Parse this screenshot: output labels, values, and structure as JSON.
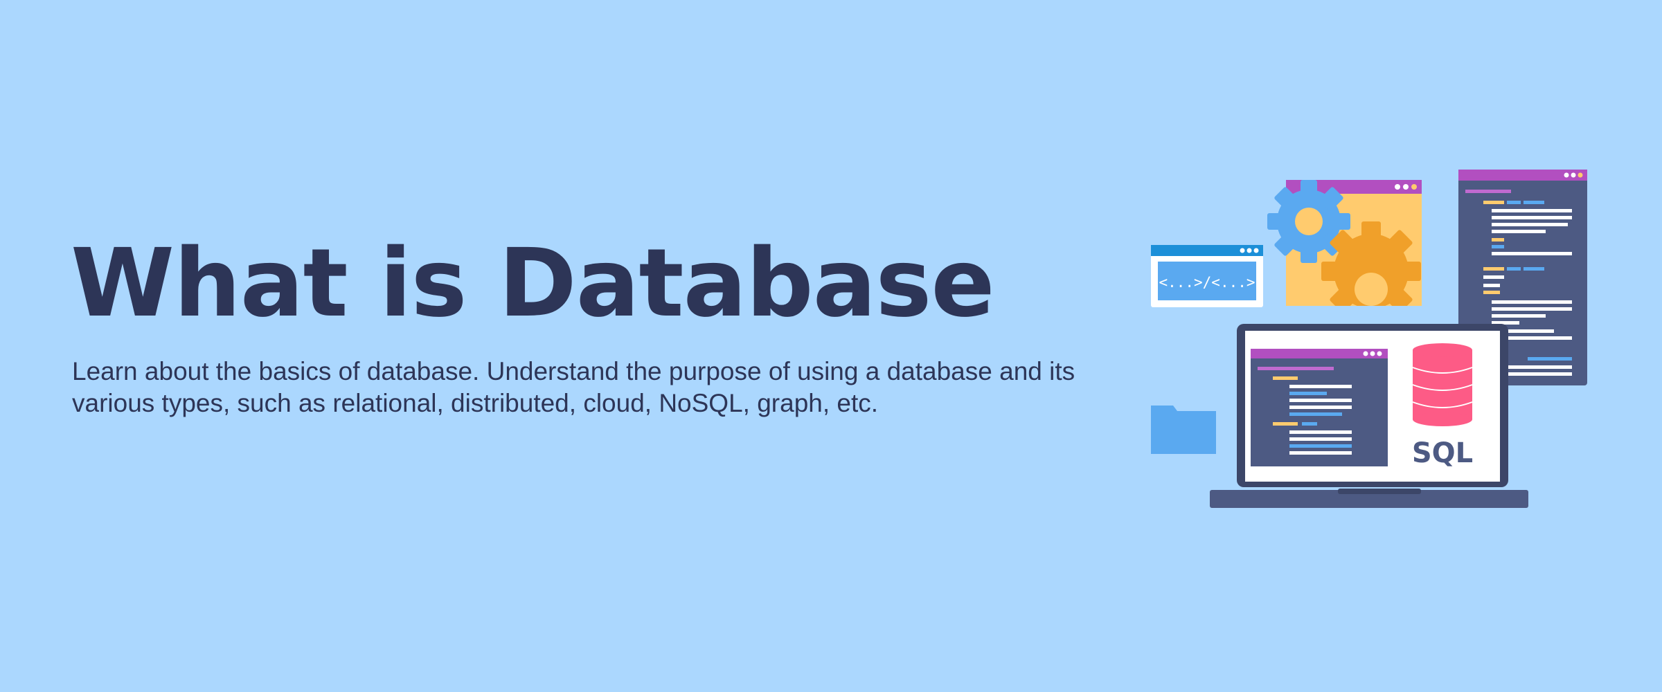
{
  "title": "What is Database",
  "description": "Learn about the basics of database. Understand the purpose of using a database and its various types, such as relational, distributed, cloud, NoSQL, graph, etc.",
  "illustration": {
    "code_tag_text": "<...>/<...>",
    "db_label": "SQL",
    "icons": [
      "code-window-icon",
      "gear-window-icon",
      "code-panel-icon",
      "folder-icon",
      "laptop-icon",
      "database-icon"
    ]
  },
  "colors": {
    "background": "#abd7fe",
    "text": "#2d3557",
    "window_header": "#b24fc0",
    "panel": "#4d5a83",
    "gear_bg": "#ffcb6e",
    "gear_dark": "#f0a02a",
    "blue": "#5aa9f0",
    "db": "#fd5b86"
  }
}
